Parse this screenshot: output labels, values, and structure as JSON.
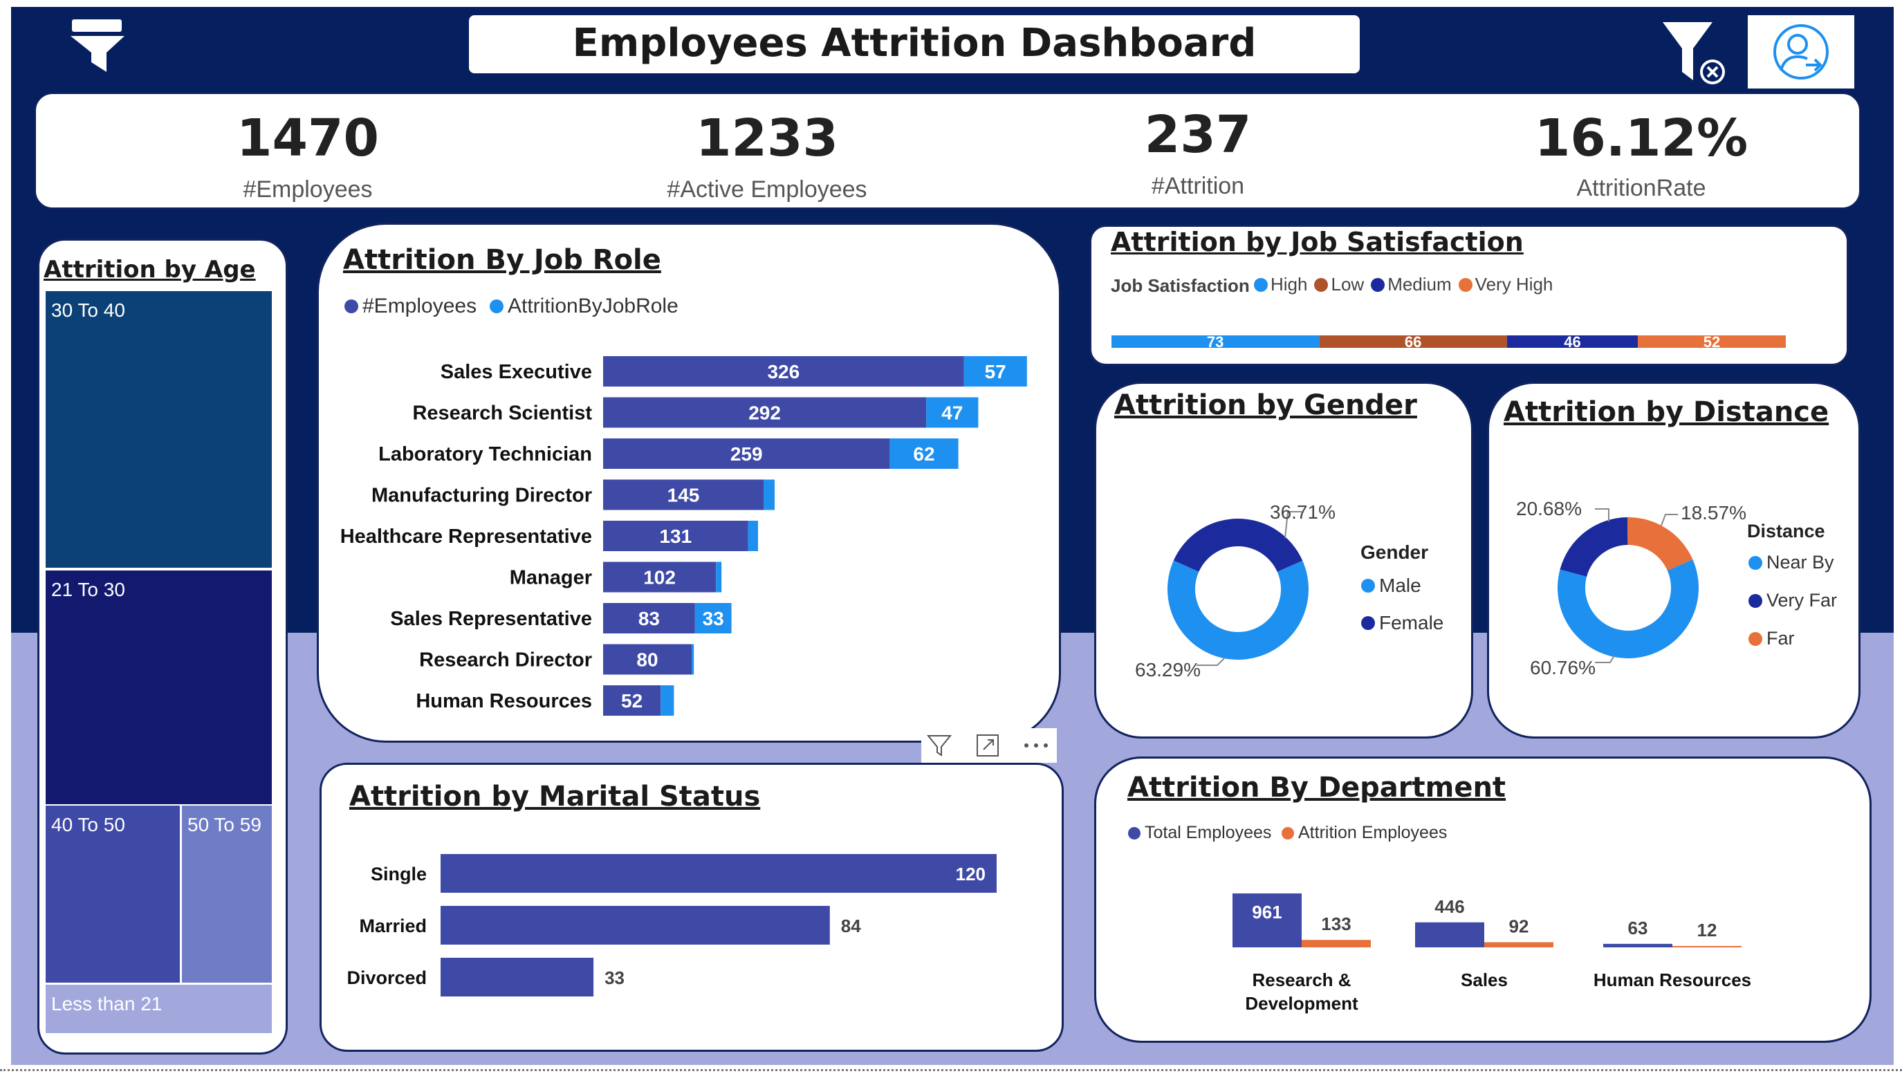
{
  "header": {
    "title": "Employees Attrition Dashboard",
    "icons": [
      "funnel-icon",
      "clear-filter-icon",
      "user-account-icon"
    ]
  },
  "kpis": [
    {
      "value": "1470",
      "label": "#Employees"
    },
    {
      "value": "1233",
      "label": "#Active Employees"
    },
    {
      "value": "237",
      "label": "#Attrition"
    },
    {
      "value": "16.12%",
      "label": "AttritionRate"
    }
  ],
  "age": {
    "title": "Attrition by Age",
    "segments": [
      {
        "label": "30 To 40",
        "color": "#0b4177"
      },
      {
        "label": "21 To 30",
        "color": "#12196e"
      },
      {
        "label": "40 To 50",
        "color": "#3f4aa7"
      },
      {
        "label": "50 To 59",
        "color": "#6f7cc6"
      },
      {
        "label": "Less than 21",
        "color": "#a2a8dc"
      }
    ]
  },
  "job_role": {
    "title": "Attrition By Job Role",
    "legend": [
      "#Employees",
      "AttritionByJobRole"
    ]
  },
  "marital": {
    "title": "Attrition by Marital Status",
    "visual_icons": [
      "filter-icon",
      "focus-mode-icon",
      "more-options-icon"
    ]
  },
  "satisfaction": {
    "title": "Attrition by Job Satisfaction",
    "legend_title": "Job Satisfaction",
    "legend": [
      "High",
      "Low",
      "Medium",
      "Very High"
    ]
  },
  "gender": {
    "title": "Attrition by Gender",
    "legend_title": "Gender",
    "legend": [
      "Male",
      "Female"
    ],
    "labels": [
      "36.71%",
      "63.29%"
    ]
  },
  "distance": {
    "title": "Attrition by Distance",
    "legend_title": "Distance",
    "legend": [
      "Near By",
      "Very Far",
      "Far"
    ],
    "labels": [
      "20.68%",
      "18.57%",
      "60.76%"
    ]
  },
  "department": {
    "title": "Attrition By Department",
    "legend": [
      "Total Employees",
      "Attrition Employees"
    ]
  },
  "colors": {
    "navy": "#061f5e",
    "lavender": "#a2a8dc",
    "bar_primary": "#3f4aa7",
    "bar_light": "#1e90f0",
    "orange": "#e8703a",
    "brown": "#b1532a",
    "dark_blue": "#1b2a9c"
  },
  "chart_data": [
    {
      "type": "bar",
      "title": "Attrition By Job Role",
      "orientation": "horizontal",
      "stacked": true,
      "categories": [
        "Sales Executive",
        "Research Scientist",
        "Laboratory Technician",
        "Manufacturing Director",
        "Healthcare Representative",
        "Manager",
        "Sales Representative",
        "Research Director",
        "Human Resources"
      ],
      "series": [
        {
          "name": "#Employees",
          "values": [
            326,
            292,
            259,
            145,
            131,
            102,
            83,
            80,
            52
          ]
        },
        {
          "name": "AttritionByJobRole",
          "values": [
            57,
            47,
            62,
            10,
            9,
            5,
            33,
            2,
            12
          ]
        }
      ]
    },
    {
      "type": "bar",
      "title": "Attrition by Marital Status",
      "orientation": "horizontal",
      "categories": [
        "Single",
        "Married",
        "Divorced"
      ],
      "values": [
        120,
        84,
        33
      ]
    },
    {
      "type": "bar",
      "title": "Attrition by Job Satisfaction",
      "orientation": "horizontal",
      "stacked": true,
      "legend_title": "Job Satisfaction",
      "series": [
        {
          "name": "High",
          "values": [
            73
          ],
          "color": "#1e90f0"
        },
        {
          "name": "Low",
          "values": [
            66
          ],
          "color": "#b1532a"
        },
        {
          "name": "Medium",
          "values": [
            46
          ],
          "color": "#1b2a9c"
        },
        {
          "name": "Very High",
          "values": [
            52
          ],
          "color": "#e8703a"
        }
      ]
    },
    {
      "type": "pie",
      "title": "Attrition by Gender",
      "legend_title": "Gender",
      "slices": [
        {
          "name": "Male",
          "value": 63.29,
          "label": "63.29%",
          "color": "#1e90f0"
        },
        {
          "name": "Female",
          "value": 36.71,
          "label": "36.71%",
          "color": "#1b2a9c"
        }
      ]
    },
    {
      "type": "pie",
      "title": "Attrition by Distance",
      "legend_title": "Distance",
      "slices": [
        {
          "name": "Near By",
          "value": 60.76,
          "label": "60.76%",
          "color": "#1e90f0"
        },
        {
          "name": "Very Far",
          "value": 20.68,
          "label": "20.68%",
          "color": "#1b2a9c"
        },
        {
          "name": "Far",
          "value": 18.57,
          "label": "18.57%",
          "color": "#e8703a"
        }
      ]
    },
    {
      "type": "bar",
      "title": "Attrition By Department",
      "categories": [
        "Research & Development",
        "Sales",
        "Human Resources"
      ],
      "series": [
        {
          "name": "Total Employees",
          "values": [
            961,
            446,
            63
          ],
          "color": "#3f4aa7"
        },
        {
          "name": "Attrition Employees",
          "values": [
            133,
            92,
            12
          ],
          "color": "#e8703a"
        }
      ]
    },
    {
      "type": "heatmap",
      "title": "Attrition by Age",
      "categories": [
        "30 To 40",
        "21 To 30",
        "40 To 50",
        "50 To 59",
        "Less than 21"
      ]
    }
  ]
}
